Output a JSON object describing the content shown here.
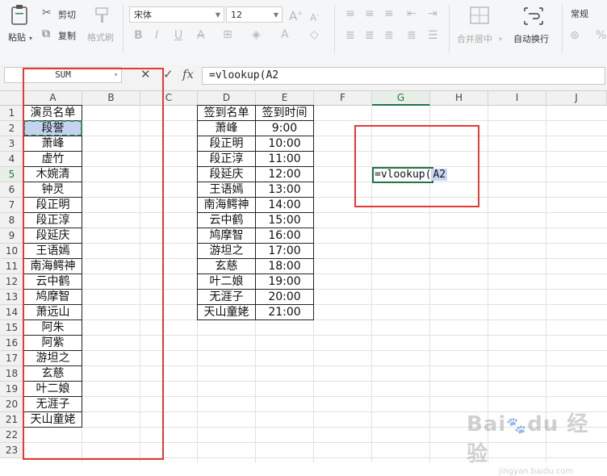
{
  "ribbon": {
    "paste_label": "粘贴",
    "cut_label": "剪切",
    "copy_label": "复制",
    "format_painter_label": "格式刷",
    "font_name": "宋体",
    "font_size": "12",
    "merge_center_label": "合并居中",
    "wrap_text_label": "自动换行",
    "number_format": "常规"
  },
  "formula_bar": {
    "name_box": "SUM",
    "fx_label": "fx",
    "formula": "=vlookup(A2"
  },
  "columns": [
    "A",
    "B",
    "C",
    "D",
    "E",
    "F",
    "G",
    "H",
    "I",
    "J"
  ],
  "rows": [
    "1",
    "2",
    "3",
    "4",
    "5",
    "6",
    "7",
    "8",
    "9",
    "10",
    "11",
    "12",
    "13",
    "14",
    "15",
    "16",
    "17",
    "18",
    "19",
    "20",
    "21",
    "22",
    "23"
  ],
  "column_a": {
    "header": "演员名单",
    "values": [
      "段誉",
      "萧峰",
      "虚竹",
      "木婉清",
      "钟灵",
      "段正明",
      "段正淳",
      "段延庆",
      "王语嫣",
      "南海鳄神",
      "云中鹤",
      "鸠摩智",
      "萧远山",
      "阿朱",
      "阿紫",
      "游坦之",
      "玄慈",
      "叶二娘",
      "无涯子",
      "天山童姥"
    ]
  },
  "table_de": {
    "header_d": "签到名单",
    "header_e": "签到时间",
    "rows": [
      [
        "萧峰",
        "9:00"
      ],
      [
        "段正明",
        "10:00"
      ],
      [
        "段正淳",
        "11:00"
      ],
      [
        "段延庆",
        "12:00"
      ],
      [
        "王语嫣",
        "13:00"
      ],
      [
        "南海鳄神",
        "14:00"
      ],
      [
        "云中鹤",
        "15:00"
      ],
      [
        "鸠摩智",
        "16:00"
      ],
      [
        "游坦之",
        "17:00"
      ],
      [
        "玄慈",
        "18:00"
      ],
      [
        "叶二娘",
        "19:00"
      ],
      [
        "无涯子",
        "20:00"
      ],
      [
        "天山童姥",
        "21:00"
      ]
    ]
  },
  "editing_cell": {
    "text": "=vlookup(",
    "ref": "A2"
  },
  "colors": {
    "accent_green": "#217346",
    "annotation_red": "#e53935",
    "reference_highlight": "#c5d3f1"
  }
}
